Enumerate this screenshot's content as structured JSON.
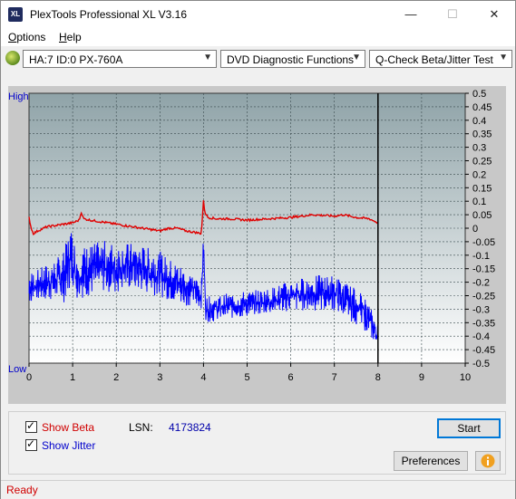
{
  "window": {
    "title": "PlexTools Professional XL V3.16",
    "icon_text": "XL"
  },
  "titlebar_controls": {
    "minimize": "—",
    "maximize": "☐",
    "close": "✕"
  },
  "menu": [
    {
      "label": "Options"
    },
    {
      "label": "Help"
    }
  ],
  "toolbar": {
    "drive": "HA:7 ID:0  PX-760A",
    "function": "DVD Diagnostic Functions",
    "test": "Q-Check Beta/Jitter Test"
  },
  "chart_data": {
    "type": "line",
    "left_axis_labels": {
      "top": "High",
      "bottom": "Low"
    },
    "x_ticks": [
      0,
      1,
      2,
      3,
      4,
      5,
      6,
      7,
      8,
      9,
      10
    ],
    "xlim": [
      0,
      10
    ],
    "y_right_ticks": [
      "0.5",
      "0.45",
      "0.4",
      "0.35",
      "0.3",
      "0.25",
      "0.2",
      "0.15",
      "0.1",
      "0.05",
      "0",
      "-0.05",
      "-0.1",
      "-0.15",
      "-0.2",
      "-0.25",
      "-0.3",
      "-0.35",
      "-0.4",
      "-0.45",
      "-0.5"
    ],
    "ylim": [
      -0.5,
      0.5
    ],
    "cursor_x": 8,
    "series": [
      {
        "color": "#e00000",
        "x": [
          0,
          0.05,
          0.1,
          0.2,
          0.4,
          0.6,
          0.8,
          1.0,
          1.15,
          1.2,
          1.25,
          1.4,
          1.6,
          1.8,
          2.0,
          2.2,
          2.4,
          2.6,
          2.8,
          3.0,
          3.2,
          3.4,
          3.6,
          3.8,
          3.95,
          4.0,
          4.03,
          4.1,
          4.3,
          4.6,
          5.0,
          5.5,
          6.0,
          6.5,
          7.0,
          7.2,
          7.5,
          7.8,
          8.0
        ],
        "values": [
          0.04,
          0.0,
          -0.02,
          -0.01,
          0.005,
          0.01,
          0.015,
          0.02,
          0.03,
          0.06,
          0.035,
          0.03,
          0.025,
          0.02,
          0.015,
          0.01,
          0.005,
          0.0,
          -0.005,
          -0.01,
          0.0,
          0.0,
          -0.01,
          -0.015,
          -0.02,
          0.1,
          0.06,
          0.04,
          0.035,
          0.035,
          0.03,
          0.035,
          0.04,
          0.05,
          0.045,
          0.05,
          0.04,
          0.035,
          0.02
        ]
      },
      {
        "color": "#0000ff",
        "x": [
          0,
          0.2,
          0.4,
          0.6,
          0.8,
          0.95,
          1.0,
          1.1,
          1.3,
          1.5,
          1.7,
          2.0,
          2.2,
          2.4,
          2.6,
          2.8,
          3.0,
          3.2,
          3.4,
          3.6,
          3.8,
          3.95,
          4.0,
          4.05,
          4.2,
          4.5,
          5.0,
          5.5,
          6.0,
          6.5,
          7.0,
          7.3,
          7.6,
          7.8,
          8.0
        ],
        "values": [
          -0.22,
          -0.21,
          -0.2,
          -0.19,
          -0.18,
          -0.1,
          -0.12,
          -0.17,
          -0.16,
          -0.15,
          -0.14,
          -0.15,
          -0.14,
          -0.14,
          -0.15,
          -0.16,
          -0.17,
          -0.19,
          -0.2,
          -0.22,
          -0.23,
          -0.25,
          -0.07,
          -0.3,
          -0.3,
          -0.29,
          -0.28,
          -0.27,
          -0.25,
          -0.24,
          -0.24,
          -0.27,
          -0.3,
          -0.34,
          -0.4
        ],
        "spread": [
          0.06,
          0.06,
          0.07,
          0.08,
          0.1,
          0.12,
          0.1,
          0.1,
          0.1,
          0.1,
          0.1,
          0.1,
          0.09,
          0.09,
          0.09,
          0.09,
          0.09,
          0.08,
          0.08,
          0.07,
          0.06,
          0.05,
          0.05,
          0.05,
          0.05,
          0.05,
          0.05,
          0.05,
          0.06,
          0.07,
          0.07,
          0.07,
          0.07,
          0.06,
          0.05
        ]
      }
    ]
  },
  "controls": {
    "show_beta": {
      "label": "Show Beta",
      "checked": true,
      "color": "#d00000"
    },
    "show_jitter": {
      "label": "Show Jitter",
      "checked": true,
      "color": "#0000cc"
    },
    "lsn_label": "LSN:",
    "lsn_value": "4173824",
    "start_label": "Start",
    "preferences_label": "Preferences",
    "info_icon": "info-icon"
  },
  "status": "Ready"
}
